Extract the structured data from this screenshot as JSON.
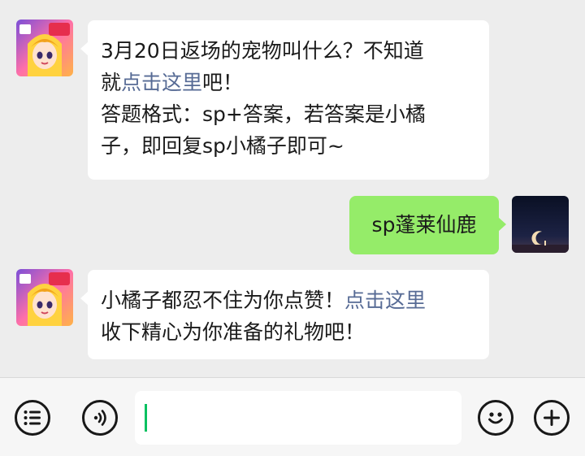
{
  "messages": [
    {
      "side": "left",
      "avatar": "game-character-avatar",
      "parts": [
        {
          "text": "3月20日返场的宠物叫什么？不知道"
        },
        {
          "text": "就"
        },
        {
          "text": "点击这里",
          "link": true
        },
        {
          "text": "吧！"
        },
        {
          "text": "答题格式：sp+答案，若答案是小橘"
        },
        {
          "text": "子，即回复sp小橘子即可~"
        }
      ]
    },
    {
      "side": "right",
      "avatar": "night-moon-avatar",
      "text": "sp蓬莱仙鹿"
    },
    {
      "side": "left",
      "avatar": "game-character-avatar",
      "parts": [
        {
          "text": "小橘子都忍不住为你点赞！"
        },
        {
          "text": "点击这里",
          "link": true
        },
        {
          "text": "收下精心为你准备的礼物吧！"
        }
      ]
    }
  ],
  "input_bar": {
    "value": "",
    "icons": [
      "menu-icon",
      "voice-icon",
      "emoji-icon",
      "plus-icon"
    ]
  }
}
